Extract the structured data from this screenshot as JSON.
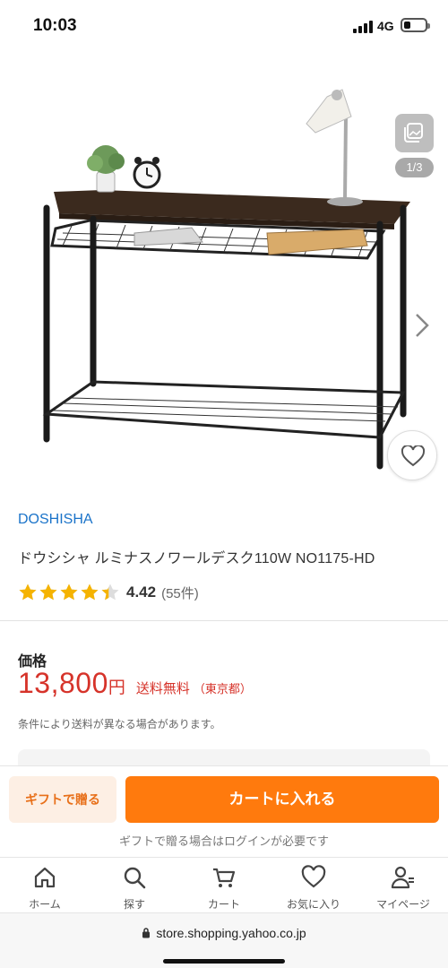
{
  "status_bar": {
    "time": "10:03",
    "network": "4G",
    "battery_level": 0.3
  },
  "gallery": {
    "counter": "1/3",
    "icons": {
      "gallery": "gallery-icon",
      "next": "chevron-right-icon",
      "favorite": "heart-icon"
    }
  },
  "product": {
    "brand": "DOSHISHA",
    "title": "ドウシシャ ルミナスノワールデスク110W NO1175-HD",
    "rating": {
      "stars": 4.42,
      "value": "4.42",
      "count": "(55件)"
    }
  },
  "price": {
    "label": "価格",
    "value": "13,800",
    "unit": "円",
    "shipping": "送料無料",
    "shipping_from": "（東京都）",
    "note": "条件により送料が異なる場合があります。"
  },
  "actions": {
    "gift_label": "ギフトで贈る",
    "cart_label": "カートに入れる",
    "login_note": "ギフトで贈る場合はログインが必要です"
  },
  "tabs": [
    {
      "label": "ホーム",
      "icon": "home-icon"
    },
    {
      "label": "探す",
      "icon": "search-icon"
    },
    {
      "label": "カート",
      "icon": "cart-icon"
    },
    {
      "label": "お気に入り",
      "icon": "heart-icon"
    },
    {
      "label": "マイページ",
      "icon": "user-icon"
    }
  ],
  "browser": {
    "url": "store.shopping.yahoo.co.jp"
  },
  "colors": {
    "brand_link": "#1a73c9",
    "price": "#d6332a",
    "accent": "#ff7a0d",
    "star": "#f5b301"
  }
}
